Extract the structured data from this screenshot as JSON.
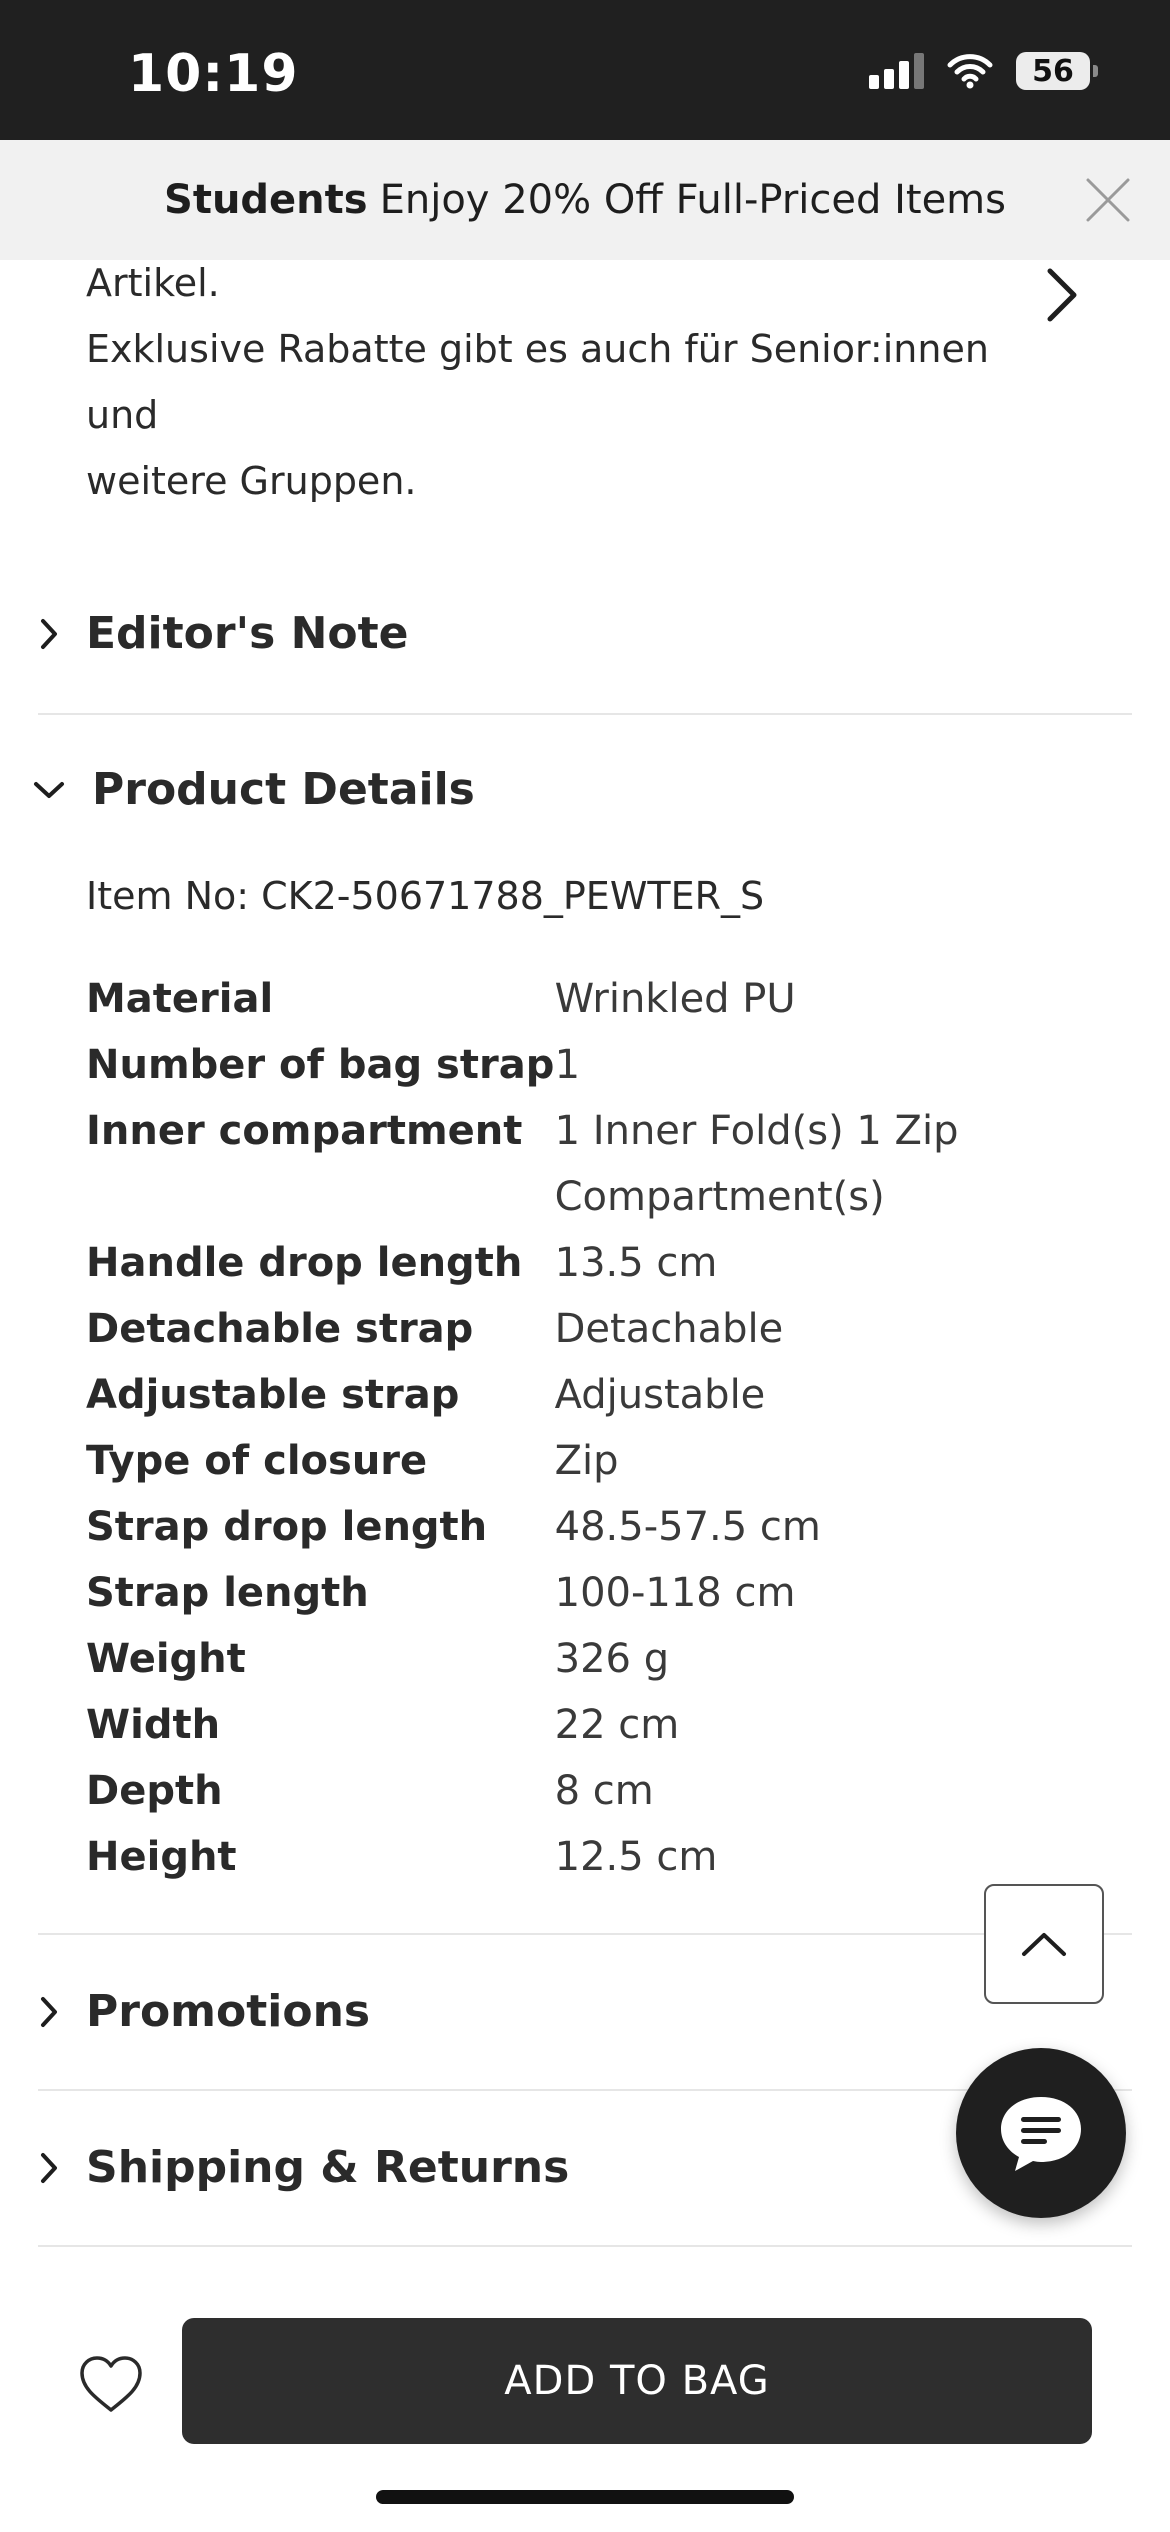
{
  "status_bar": {
    "time": "10:19",
    "battery": "56"
  },
  "promo_banner": {
    "bold": "Students",
    "text": "Enjoy 20% Off Full-Priced Items"
  },
  "discount_info": {
    "line1": "Artikel.",
    "line2": "Exklusive Rabatte gibt es auch für Senior:innen und",
    "line3": "weitere Gruppen."
  },
  "sections": {
    "editors_note": "Editor's Note",
    "product_details": "Product Details",
    "promotions": "Promotions",
    "shipping_returns": "Shipping & Returns"
  },
  "product_details": {
    "item_no": "Item No: CK2-50671788_PEWTER_S",
    "rows": [
      {
        "label": "Material",
        "value": "Wrinkled PU"
      },
      {
        "label": "Number of bag strap",
        "value": "1"
      },
      {
        "label": "Inner compartment",
        "value": "1 Inner Fold(s) 1 Zip Compartment(s)"
      },
      {
        "label": "Handle drop length",
        "value": "13.5 cm"
      },
      {
        "label": "Detachable strap",
        "value": "Detachable"
      },
      {
        "label": "Adjustable strap",
        "value": "Adjustable"
      },
      {
        "label": "Type of closure",
        "value": "Zip"
      },
      {
        "label": "Strap drop length",
        "value": "48.5-57.5 cm"
      },
      {
        "label": "Strap length",
        "value": "100-118 cm"
      },
      {
        "label": "Weight",
        "value": "326 g"
      },
      {
        "label": "Width",
        "value": "22 cm"
      },
      {
        "label": "Depth",
        "value": "8 cm"
      },
      {
        "label": "Height",
        "value": "12.5 cm"
      }
    ]
  },
  "bottom_bar": {
    "add_to_bag": "ADD TO BAG"
  },
  "icons": {
    "close": "close-icon",
    "chevron_right": "chevron-right-icon",
    "chevron_down": "chevron-down-icon",
    "chevron_up": "chevron-up-icon",
    "chat": "chat-icon",
    "heart": "heart-icon",
    "wifi": "wifi-icon",
    "signal": "signal-icon",
    "battery": "battery-icon"
  },
  "colors": {
    "status_bar_bg": "#202020",
    "banner_bg": "#f1f1f1",
    "button_bg": "#2e2e2e",
    "text": "#2a2a2a"
  }
}
